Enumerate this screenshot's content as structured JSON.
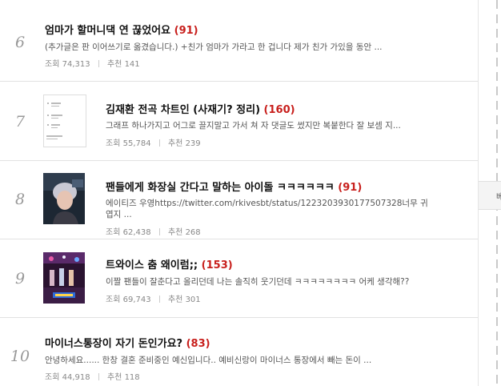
{
  "posts": [
    {
      "rank": "6",
      "title": "엄마가 할머니댁 연 끊었어요",
      "comments": "(91)",
      "summary": "(추가글은 판 이어쓰기로 옮겼습니다.) +친가 엄마가 가라고 한 겁니다 제가 친가 가있을 동안 ...",
      "views_label": "조회",
      "views": "74,313",
      "recs_label": "추천",
      "recs": "141"
    },
    {
      "rank": "7",
      "title": "김재환 전곡 차트인 (사재기? 정리)",
      "comments": "(160)",
      "summary": "그래프 하나가지고 어그로 끌지말고 가서 쳐 자 댓글도 썼지만 복붙한다 잘 보셈 지...",
      "views_label": "조회",
      "views": "55,784",
      "recs_label": "추천",
      "recs": "239"
    },
    {
      "rank": "8",
      "title": "팬들에게 화장실 간다고 말하는 아이돌 ㅋㅋㅋㅋㅋㅋ",
      "comments": "(91)",
      "summary": "에이티즈 우영https://twitter.com/rkivesbt/status/1223203930177507328너무 귀",
      "summary2": "엽지 ...",
      "views_label": "조회",
      "views": "62,438",
      "recs_label": "추천",
      "recs": "268"
    },
    {
      "rank": "9",
      "title": "트와이스 춤 왜이럼;;",
      "comments": "(153)",
      "summary": "이짤 팬들이 잘춘다고 올리던데 나는 솔직히 웃기던데 ㅋㅋㅋㅋㅋㅋㅋㅋ 어케 생각해??",
      "views_label": "조회",
      "views": "69,743",
      "recs_label": "추천",
      "recs": "301"
    },
    {
      "rank": "10",
      "title": "마이너스통장이 자기 돈인가요?",
      "comments": "(83)",
      "summary": "안녕하세요...... 한창 결혼 준비중인 예신입니다.. 예비신랑이 마이너스 통장에서 빼는 돈이 ...",
      "views_label": "조회",
      "views": "44,918",
      "recs_label": "추천",
      "recs": "118"
    }
  ],
  "sidebar": {
    "panel_label": "베"
  },
  "colors": {
    "comment_count": "#c8201d",
    "text": "#111111",
    "muted": "#888888",
    "border": "#e2e2e2"
  }
}
